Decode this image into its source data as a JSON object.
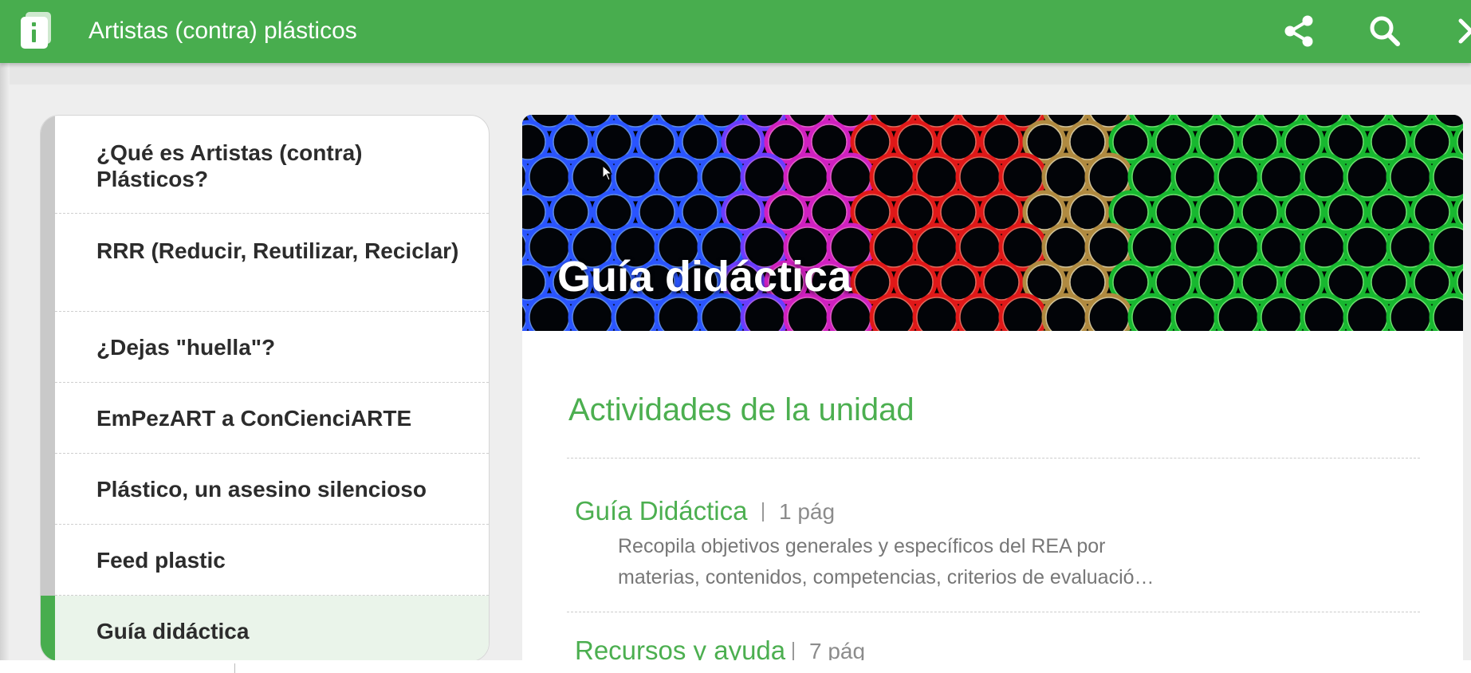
{
  "topbar": {
    "title": "Artistas (contra) plásticos",
    "background": "#48ad4e",
    "icons": {
      "app": "book-info-icon",
      "share": "share-icon",
      "search": "search-icon",
      "close": "close-icon"
    }
  },
  "sidebar": {
    "items": [
      {
        "label": "¿Qué es Artistas (contra) Plásticos?",
        "active": false
      },
      {
        "label": "RRR (Reducir, Reutilizar, Reciclar)",
        "active": false
      },
      {
        "label": "¿Dejas \"huella\"?",
        "active": false
      },
      {
        "label": "EmPezART a ConCienciARTE",
        "active": false
      },
      {
        "label": "Plástico, un asesino silencioso",
        "active": false
      },
      {
        "label": "Feed plastic",
        "active": false
      },
      {
        "label": "Guía didáctica",
        "active": true
      }
    ],
    "accent": "#48ad4e"
  },
  "main": {
    "hero_title": "Guía didáctica",
    "section_heading": "Actividades de la unidad",
    "activities": [
      {
        "title": "Guía Didáctica",
        "pages": "1 pág",
        "description": "Recopila objetivos generales y específicos del REA por materias, contenidos, competencias, criterios de evaluació…"
      },
      {
        "title": "Recursos y ayuda",
        "pages": "7 pág",
        "description": ""
      }
    ]
  },
  "colors": {
    "accent_green": "#4caf50",
    "text_dark": "#2c2c2c",
    "text_muted": "#777777",
    "active_bg": "#eaf4ea"
  }
}
